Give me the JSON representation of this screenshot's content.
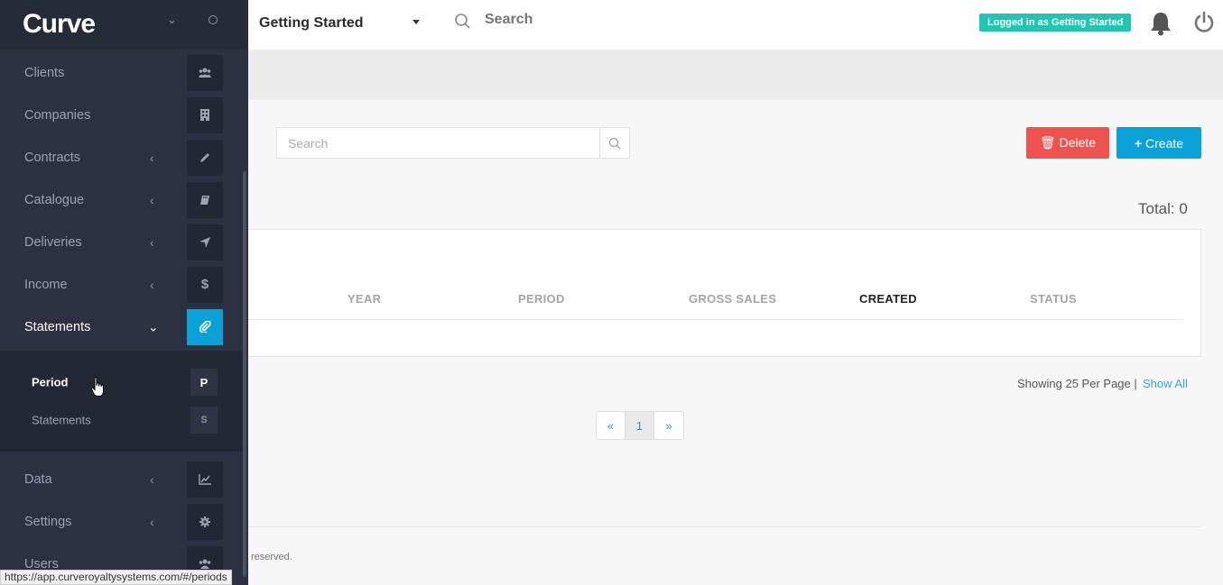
{
  "app": {
    "logo": "Curve"
  },
  "sidebar": {
    "items": [
      {
        "label": "Clients",
        "icon": "users-icon",
        "has_chevron": false
      },
      {
        "label": "Companies",
        "icon": "building-icon",
        "has_chevron": false
      },
      {
        "label": "Contracts",
        "icon": "pencil-icon",
        "has_chevron": true
      },
      {
        "label": "Catalogue",
        "icon": "book-icon",
        "has_chevron": true
      },
      {
        "label": "Deliveries",
        "icon": "send-icon",
        "has_chevron": true
      },
      {
        "label": "Income",
        "icon": "dollar-icon",
        "has_chevron": true
      },
      {
        "label": "Statements",
        "icon": "paperclip-icon",
        "has_chevron": true,
        "active": true
      },
      {
        "label": "Data",
        "icon": "chart-icon",
        "has_chevron": true
      },
      {
        "label": "Settings",
        "icon": "gear-icon",
        "has_chevron": true
      },
      {
        "label": "Users",
        "icon": "users-icon",
        "has_chevron": false
      }
    ],
    "submenu": [
      {
        "label": "Period",
        "letter": "P",
        "active": true
      },
      {
        "label": "Statements",
        "letter": "S",
        "active": false
      }
    ]
  },
  "topbar": {
    "company": "Getting Started",
    "search_placeholder": "Search",
    "login_badge": "Logged in as Getting Started"
  },
  "content": {
    "search_placeholder": "Search",
    "delete_label": "Delete",
    "create_label": "Create",
    "total": "Total: 0",
    "columns": [
      "YEAR",
      "PERIOD",
      "GROSS SALES",
      "CREATED",
      "STATUS"
    ],
    "sorted_column": "CREATED",
    "showing": "Showing 25 Per Page |",
    "show_all": "Show All",
    "pager": {
      "prev": "«",
      "current": "1",
      "next": "»"
    },
    "footer": "reserved."
  },
  "statusbar": "https://app.curveroyaltysystems.com/#/periods",
  "colors": {
    "accent": "#0aa0d8",
    "danger": "#ef5350",
    "badge": "#22c4b4",
    "sidebar": "#2b3140"
  }
}
